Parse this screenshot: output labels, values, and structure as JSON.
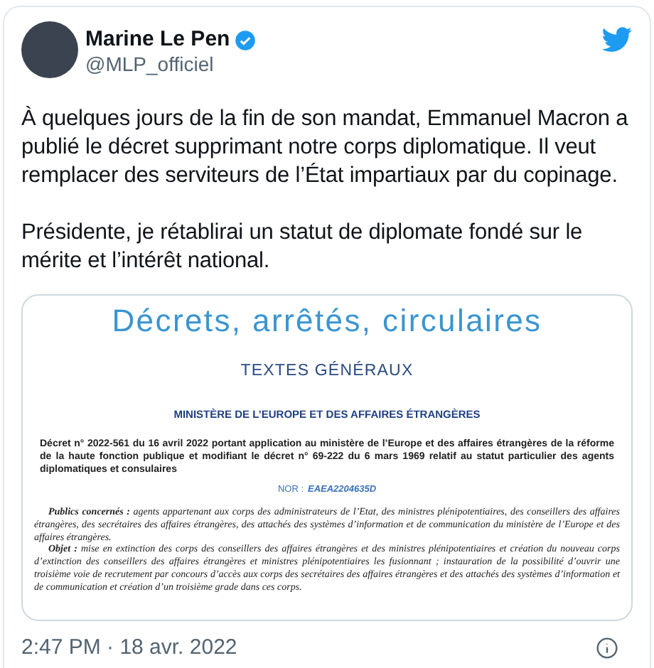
{
  "author": {
    "name": "Marine Le Pen",
    "verified": true,
    "handle": "@MLP_officiel"
  },
  "tweet": {
    "paragraphs": [
      "À quelques jours de la fin de son mandat, Emmanuel Macron a publié le décret supprimant notre corps diplomatique. Il veut remplacer des serviteurs de l’État impartiaux par du copinage.",
      "Présidente, je rétablirai un statut de diplomate fondé sur le mérite et l’intérêt national."
    ]
  },
  "document": {
    "title": "Décrets, arrêtés, circulaires",
    "section": "TEXTES GÉNÉRAUX",
    "ministry": "MINISTÈRE DE L’EUROPE ET DES AFFAIRES ÉTRANGÈRES",
    "decree": "Décret n° 2022-561 du 16 avril 2022 portant application au ministère de l’Europe et des affaires étrangères de la réforme de la haute fonction publique et modifiant le décret n° 69-222 du 6 mars 1969 relatif au statut particulier des agents diplomatiques et consulaires",
    "nor_label": "NOR :",
    "nor": "EAEA2204635D",
    "body": [
      "**Publics concernés :** agents appartenant aux corps des administrateurs de l’Etat, des ministres plénipotentiaires, des conseillers des affaires étrangères, des secrétaires des affaires étrangères, des attachés des systèmes d’information et de communication du ministère de l’Europe et des affaires étrangères.",
      "**Objet :** mise en extinction des corps des conseillers des affaires étrangères et des ministres plénipotentiaires et création du nouveau corps d’extinction des conseillers des affaires étrangères et ministres plénipotentiaires les fusionnant ; instauration de la possibilité d’ouvrir une troisième voie de recrutement par concours d’accès aux corps des secrétaires des affaires étrangères et des attachés des systèmes d’information et de communication et création d’un troisième grade dans ces corps."
    ]
  },
  "timestamp": "2:47 PM · 18 avr. 2022"
}
